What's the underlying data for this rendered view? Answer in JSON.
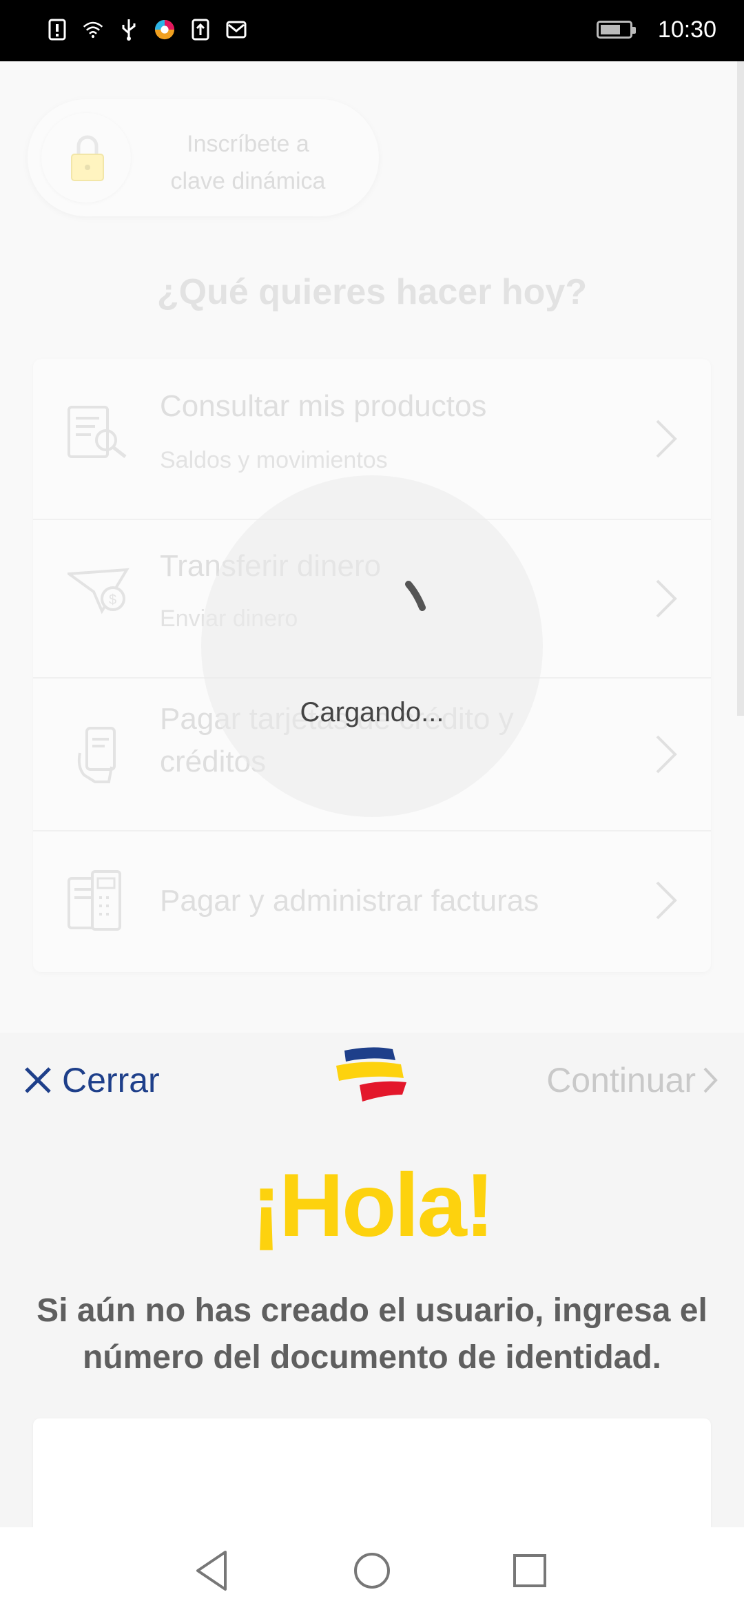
{
  "status_bar": {
    "time": "10:30",
    "icons": [
      "alert-icon",
      "wifi-icon",
      "usb-icon",
      "app-icon",
      "upload-icon",
      "mail-icon"
    ]
  },
  "background": {
    "enroll_label": "Inscríbete a clave dinámica",
    "question": "¿Qué quieres hacer hoy?",
    "menu": [
      {
        "title": "Consultar mis productos",
        "subtitle": "Saldos y movimientos",
        "icon": "document-search-icon"
      },
      {
        "title": "Transferir dinero",
        "subtitle": "Enviar dinero",
        "icon": "paper-plane-money-icon"
      },
      {
        "title": "Pagar tarjetas de crédito y créditos",
        "subtitle": "",
        "icon": "hand-card-icon"
      },
      {
        "title": "Pagar y administrar facturas",
        "subtitle": "",
        "icon": "bill-calculator-icon"
      }
    ]
  },
  "loading": {
    "text": "Cargando..."
  },
  "sheet": {
    "close_label": "Cerrar",
    "continue_label": "Continuar",
    "greeting": "¡Hola!",
    "instructions": "Si aún no has creado el usuario, ingresa el número del documento de identidad.",
    "input_value": "",
    "colors": {
      "brand_blue": "#1e3f8a",
      "brand_yellow": "#fdd20e",
      "brand_red": "#e3172b"
    }
  },
  "nav_bar": {
    "buttons": [
      "back-icon",
      "home-icon",
      "recents-icon"
    ]
  }
}
